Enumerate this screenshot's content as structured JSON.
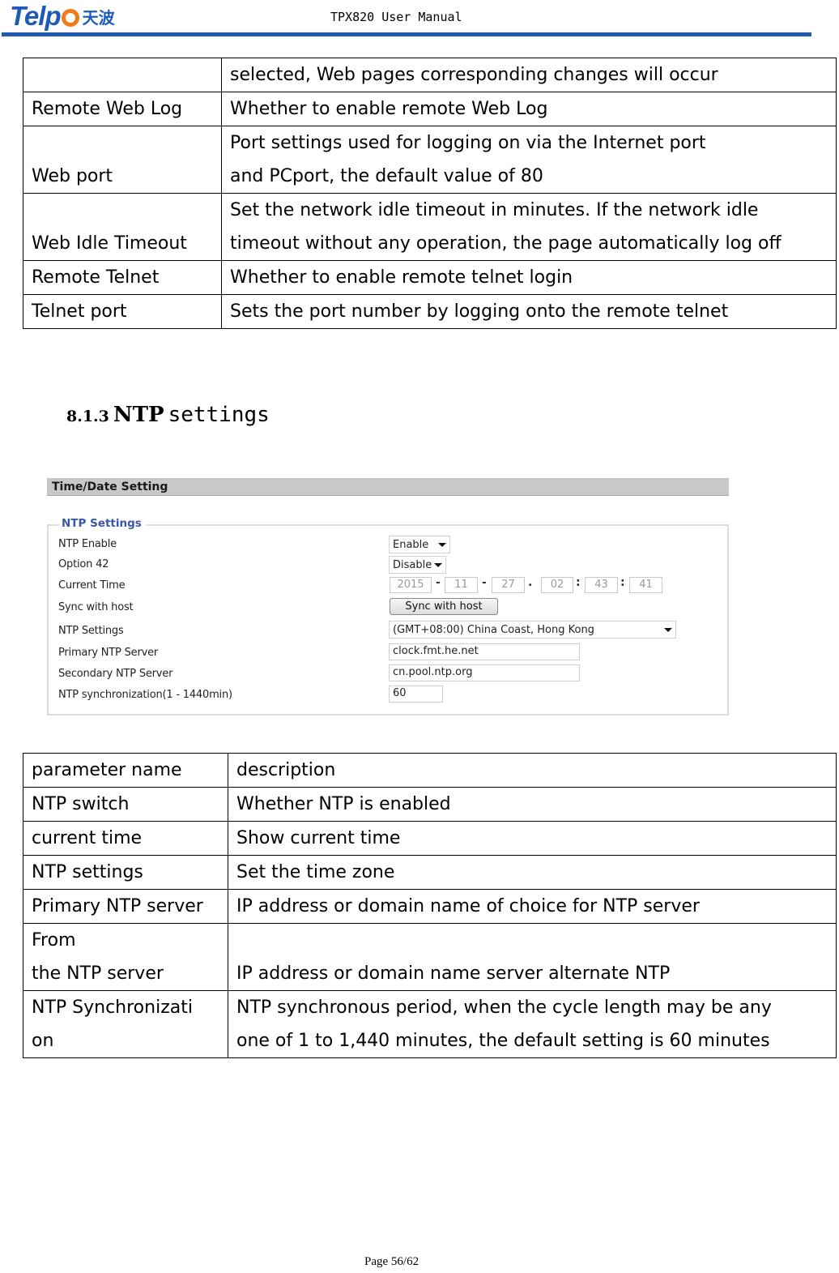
{
  "header": {
    "logo_text": "Telp",
    "logo_cn": "天波",
    "doc_title": "TPX820 User Manual"
  },
  "table1": {
    "rows": [
      {
        "name": "",
        "desc": [
          "selected, Web pages corresponding changes will occur"
        ]
      },
      {
        "name": "Remote Web Log",
        "desc": [
          "Whether to enable remote Web Log"
        ]
      },
      {
        "name": "Web port",
        "desc": [
          "Port settings used for logging on via the Internet port",
          "and PCport, the default value of 80"
        ]
      },
      {
        "name": "Web Idle Timeout",
        "desc": [
          "Set the network idle timeout in minutes. If the network idle",
          "timeout without any operation, the page automatically log off"
        ]
      },
      {
        "name": "Remote Telnet",
        "desc": [
          "Whether to enable remote telnet login"
        ]
      },
      {
        "name": "Telnet port",
        "desc": [
          "Sets the port number by logging onto the remote telnet"
        ]
      }
    ]
  },
  "section": {
    "number": "8.1.3",
    "title_bold": "NTP",
    "title_rest": "settings"
  },
  "screenshot": {
    "bar_title": "Time/Date Setting",
    "group_title": "NTP Settings",
    "labels": {
      "ntp_enable": "NTP Enable",
      "option42": "Option 42",
      "current_time": "Current Time",
      "sync_host": "Sync with host",
      "ntp_settings": "NTP Settings",
      "primary": "Primary NTP Server",
      "secondary": "Secondary NTP Server",
      "sync_interval": "NTP synchronization(1 - 1440min)"
    },
    "values": {
      "ntp_enable": "Enable",
      "option42": "Disable",
      "time": {
        "year": "2015",
        "month": "11",
        "day": "27",
        "hour": "02",
        "minute": "43",
        "second": "41"
      },
      "sep_date": "-",
      "sep_dot": ".",
      "sep_time": ":",
      "sync_button": "Sync with host",
      "timezone": "(GMT+08:00) China Coast, Hong Kong",
      "primary": "clock.fmt.he.net",
      "secondary": "cn.pool.ntp.org",
      "sync_interval": "60"
    }
  },
  "table2": {
    "header": {
      "name": "parameter name",
      "desc": "description"
    },
    "rows": [
      {
        "name": [
          "NTP switch"
        ],
        "desc": "Whether NTP is enabled"
      },
      {
        "name": [
          "current time"
        ],
        "desc": "Show current time"
      },
      {
        "name": [
          "NTP settings"
        ],
        "desc": "Set the time zone"
      },
      {
        "name": [
          "Primary NTP server"
        ],
        "desc": "IP address or domain name of choice for NTP server"
      },
      {
        "name": [
          "From",
          "the NTP server"
        ],
        "desc": "IP address or domain name server alternate NTP"
      },
      {
        "name": [
          "NTP Synchronizati",
          "on"
        ],
        "desc": [
          "NTP synchronous period, when the cycle length may be any",
          "one of 1 to 1,440 minutes, the default setting is 60 minutes"
        ]
      }
    ]
  },
  "footer": {
    "page": "Page 56/62"
  },
  "colors": {
    "brand_blue": "#1f5cab",
    "brand_orange": "#f07a1a",
    "legend_blue": "#3a58a8"
  }
}
